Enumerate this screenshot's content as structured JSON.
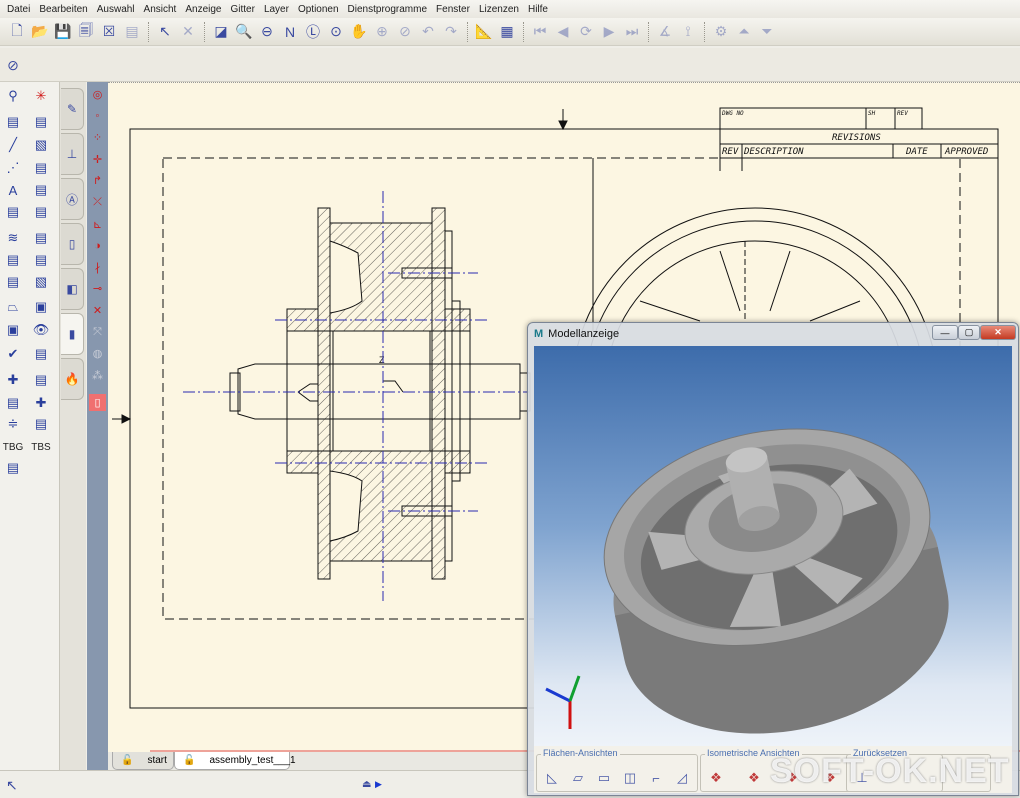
{
  "menu": [
    "Datei",
    "Bearbeiten",
    "Auswahl",
    "Ansicht",
    "Anzeige",
    "Gitter",
    "Layer",
    "Optionen",
    "Dienstprogramme",
    "Fenster",
    "Lizenzen",
    "Hilfe"
  ],
  "toolbar1": [
    {
      "icon": "new-document-icon",
      "glyph": "🗋"
    },
    {
      "icon": "open-folder-icon",
      "glyph": "📂"
    },
    {
      "icon": "save-icon",
      "glyph": "💾"
    },
    {
      "icon": "save-all-icon",
      "glyph": "🗐"
    },
    {
      "icon": "close-document-icon",
      "glyph": "☒"
    },
    {
      "icon": "print-icon",
      "glyph": "▤",
      "disabled": true
    },
    {
      "sep": true
    },
    {
      "icon": "select-arrow-icon",
      "glyph": "↖"
    },
    {
      "icon": "delete-icon",
      "glyph": "✕",
      "disabled": true
    },
    {
      "sep": true
    },
    {
      "icon": "redraw-icon",
      "glyph": "◪"
    },
    {
      "icon": "zoom-window-icon",
      "glyph": "🔍"
    },
    {
      "icon": "zoom-out-icon",
      "glyph": "⊖"
    },
    {
      "icon": "zoom-name-icon",
      "glyph": "N"
    },
    {
      "icon": "zoom-layer-icon",
      "glyph": "Ⓛ"
    },
    {
      "icon": "zoom-all-icon",
      "glyph": "⊙"
    },
    {
      "icon": "pan-hand-icon",
      "glyph": "✋"
    },
    {
      "icon": "zoom-in-icon",
      "glyph": "⊕",
      "disabled": true
    },
    {
      "icon": "zoom-previous-icon",
      "glyph": "⊘",
      "disabled": true
    },
    {
      "icon": "undo-icon",
      "glyph": "↶",
      "disabled": true
    },
    {
      "icon": "redo-icon",
      "glyph": "↷",
      "disabled": true
    },
    {
      "sep": true
    },
    {
      "icon": "measure-icon",
      "glyph": "📐"
    },
    {
      "icon": "scale-icon",
      "glyph": "▦"
    },
    {
      "sep": true
    },
    {
      "icon": "first-icon",
      "glyph": "⏮",
      "disabled": true
    },
    {
      "icon": "previous-icon",
      "glyph": "◀",
      "disabled": true
    },
    {
      "icon": "cycle-icon",
      "glyph": "⟳",
      "disabled": true
    },
    {
      "icon": "next-icon",
      "glyph": "▶",
      "disabled": true
    },
    {
      "icon": "last-icon",
      "glyph": "⏭",
      "disabled": true
    },
    {
      "sep": true
    },
    {
      "icon": "snap-angle-icon",
      "glyph": "∡",
      "disabled": true
    },
    {
      "icon": "snap-tree-icon",
      "glyph": "⟟",
      "disabled": true
    },
    {
      "sep": true
    },
    {
      "icon": "assembly-icon",
      "glyph": "⚙",
      "disabled": true
    },
    {
      "icon": "move-up-icon",
      "glyph": "⏶",
      "disabled": true
    },
    {
      "icon": "move-down-icon",
      "glyph": "⏷",
      "disabled": true
    }
  ],
  "toolbar2": [
    {
      "icon": "pen-circle-icon",
      "glyph": "⊘"
    }
  ],
  "palette": [
    [
      "snap-point-icon",
      "✲-icon"
    ],
    [
      "sheet-icon",
      "ucp-icon"
    ],
    [
      "line-icon",
      "box-3d-icon"
    ],
    [
      "dashed-line-icon",
      "diagonal-box-icon"
    ],
    [
      "text-icon",
      "scale-line-icon"
    ],
    [
      "view-block-icon",
      "page-icon"
    ],
    [
      "layers-icon",
      "layers-delete-icon"
    ],
    [
      "coordinates-icon",
      "rotate-view-icon"
    ],
    [
      "coordinates-folder-icon",
      "cube-point-icon"
    ],
    [
      "section-icon",
      "view-2d-icon"
    ],
    [
      "view-3d-icon",
      "visibility-eye-icon"
    ],
    [
      "check-icon",
      "valid-icon"
    ],
    [
      "union-icon",
      "update-icon"
    ],
    [
      "project-icon",
      "merge-icon"
    ],
    [
      "settings-icon",
      "open-icon"
    ],
    [
      "tbg-icon",
      "tbs-icon"
    ],
    [
      "fonts-icon"
    ]
  ],
  "palette_labels": {
    "tbg": "TBG",
    "tbs": "TBS"
  },
  "side_tabs": [
    "dimension-pen-icon",
    "constraint-icon",
    "text-dim-icon",
    "document-icon",
    "sheets-icon",
    "view-tab-icon",
    "flame-icon"
  ],
  "snap_strip": [
    "snap-settings-icon",
    "snap-end-icon",
    "snap-grid-icon",
    "snap-intersect-icon",
    "snap-arc-icon",
    "snap-mid-icon",
    "snap-angle-icon",
    "snap-circle-icon",
    "snap-parallel-icon",
    "snap-tangent-icon",
    "snap-cross-icon",
    "snap-free-icon",
    "snap-sphere-icon",
    "snap-cloud-icon",
    "snap-frame-icon"
  ],
  "drawing": {
    "title_block": {
      "dwg_no": "DWG NO",
      "sh": "SH",
      "rev": "REV",
      "revisions": "REVISIONS",
      "col_rev": "REV",
      "col_description": "DESCRIPTION",
      "col_date": "DATE",
      "col_approved": "APPROVED"
    },
    "section_label": "Z",
    "centerline_color": "#2a2ab0",
    "paper_color": "#fcf6e2"
  },
  "doc_tabs": [
    {
      "label": "start",
      "icon": "unlock-icon"
    },
    {
      "label": "assembly_test___1",
      "icon": "unlock-icon",
      "active": true
    }
  ],
  "model_window": {
    "title": "Modellanzeige",
    "logo": "M",
    "groups": [
      {
        "title": "Flächen-Ansichten",
        "buttons": [
          "view-right-icon",
          "view-front-icon",
          "view-back-icon",
          "view-top-icon",
          "view-left-icon",
          "view-bottom-icon"
        ]
      },
      {
        "title": "Isometrische Ansichten",
        "buttons": [
          "iso-1-icon",
          "iso-2-icon",
          "iso-3-icon",
          "iso-4-icon"
        ]
      },
      {
        "title": "Zurücksetzen",
        "buttons": [
          "reset-axes-icon"
        ]
      }
    ]
  },
  "watermark": "SOFT-OK.NET"
}
